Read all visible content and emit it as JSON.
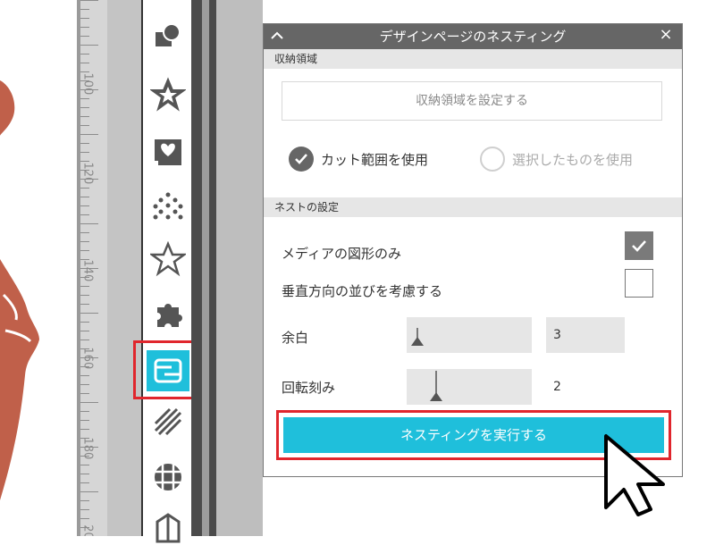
{
  "panel": {
    "title": "デザインページのネスティング",
    "close_symbol": "×",
    "collapse_symbol": "︿",
    "storage_area": {
      "section_label": "収納領域",
      "set_button_label": "収納領域を設定する",
      "options": [
        {
          "label": "カット範囲を使用",
          "selected": true
        },
        {
          "label": "選択したものを使用",
          "selected": false
        }
      ]
    },
    "nest_settings": {
      "section_label": "ネストの設定",
      "media_shape_only": {
        "label": "メディアの図形のみ",
        "checked": true
      },
      "vertical_alignment": {
        "label": "垂直方向の並びを考慮する",
        "checked": false
      },
      "margin": {
        "label": "余白",
        "value": "3"
      },
      "rotation_step": {
        "label": "回転刻み",
        "value": "2"
      }
    },
    "run_button_label": "ネスティングを実行する"
  },
  "ruler": {
    "labels": [
      "100",
      "120",
      "140",
      "160",
      "180",
      "20"
    ]
  },
  "colors": {
    "accent": "#1fbfdb",
    "highlight": "#e0262d",
    "panel_header": "#666666",
    "shape": "#c0604a"
  },
  "tools": [
    {
      "icon": "shape-arrange-icon"
    },
    {
      "icon": "star-shape-icon"
    },
    {
      "icon": "trace-image-icon"
    },
    {
      "icon": "dots-pattern-icon"
    },
    {
      "icon": "star-outline-icon"
    },
    {
      "icon": "puzzle-icon"
    },
    {
      "icon": "nesting-icon"
    },
    {
      "icon": "hatch-pattern-icon"
    },
    {
      "icon": "grid-icon"
    },
    {
      "icon": "box-3d-icon"
    }
  ]
}
